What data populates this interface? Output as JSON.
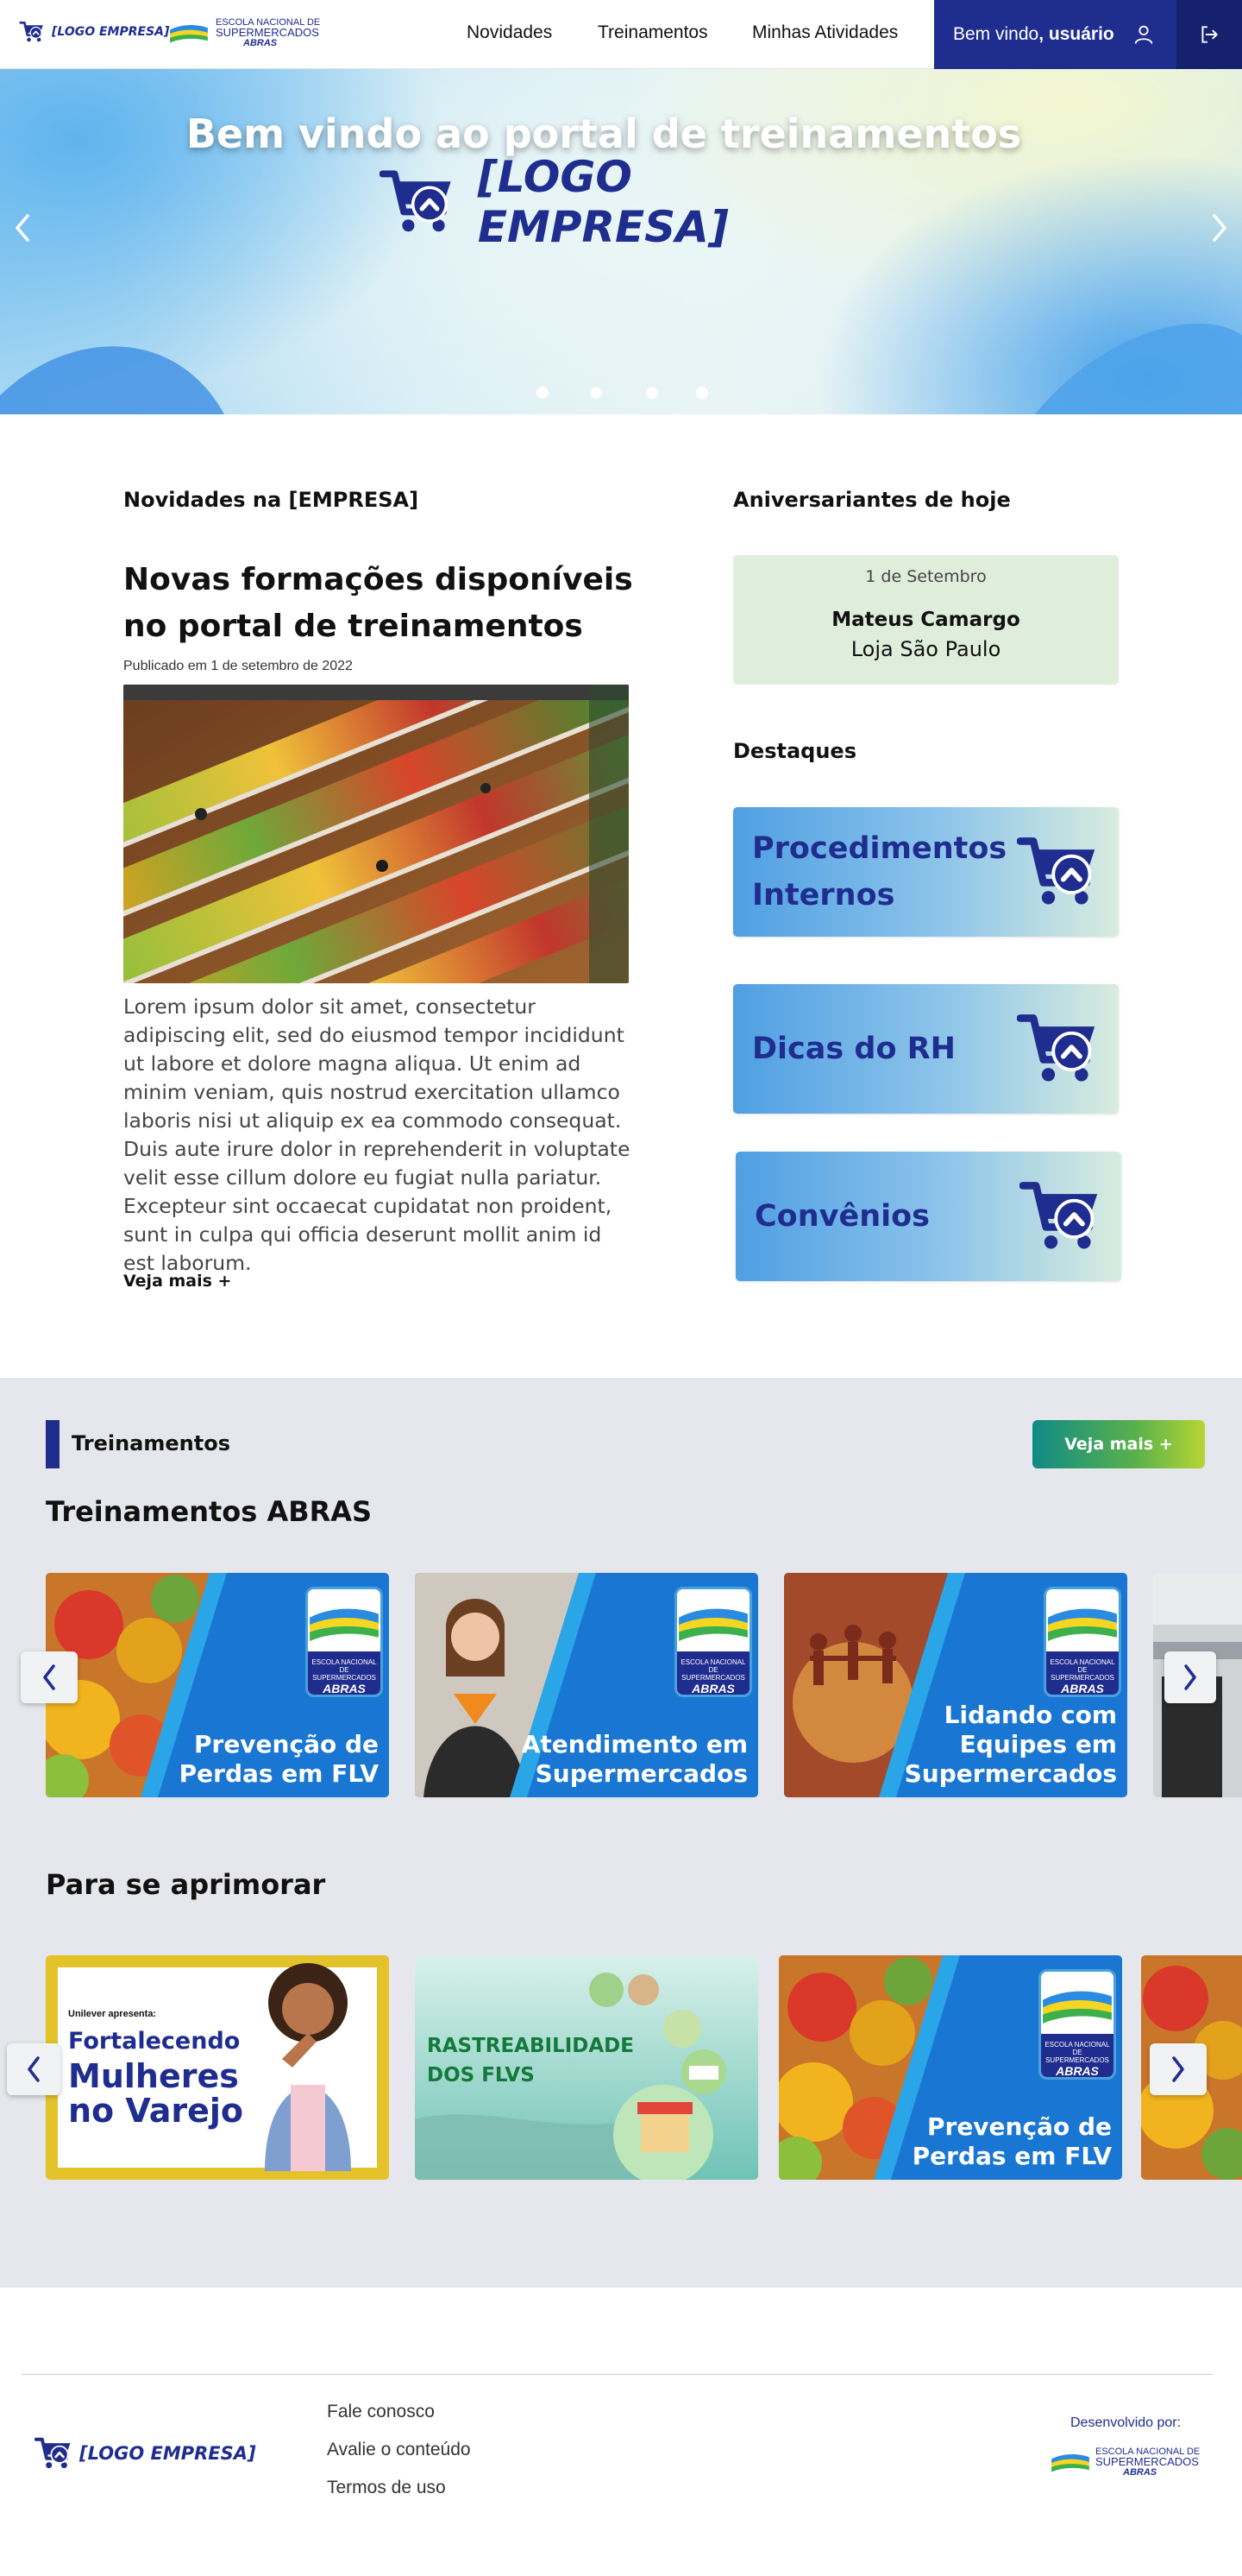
{
  "header": {
    "company_logo_text": "[LOGO EMPRESA]",
    "school_logo_lines": [
      "ESCOLA NACIONAL DE",
      "SUPERMERCADOS",
      "ABRAS"
    ],
    "nav": [
      "Novidades",
      "Treinamentos",
      "Minhas Atividades"
    ],
    "welcome_prefix": "Bem vindo",
    "welcome_user": ", usuário"
  },
  "hero": {
    "title": "Bem vindo ao portal de treinamentos",
    "logo_text": "[LOGO EMPRESA]",
    "slides": 4,
    "active_slide": 1
  },
  "news": {
    "section_title": "Novidades na [EMPRESA]",
    "headline": "Novas formações disponíveis no portal de treinamentos",
    "published": "Publicado em 1 de setembro de 2022",
    "body": "Lorem ipsum dolor sit amet, consectetur adipiscing elit, sed do eiusmod tempor incididunt ut labore et dolore magna aliqua. Ut enim ad minim veniam, quis nostrud exercitation ullamco laboris nisi ut aliquip ex ea commodo consequat. Duis aute irure dolor in reprehenderit in voluptate velit esse cillum dolore eu fugiat nulla pariatur. Excepteur sint occaecat cupidatat non proident, sunt in culpa qui officia deserunt mollit anim id est laborum.",
    "more": "Veja mais +"
  },
  "birthdays": {
    "section_title": "Aniversariantes de hoje",
    "date": "1 de Setembro",
    "name": "Mateus Camargo",
    "store": "Loja São Paulo"
  },
  "highlights": {
    "section_title": "Destaques",
    "items": [
      {
        "label_line1": "Procedimentos",
        "label_line2": "Internos"
      },
      {
        "label_line1": "Dicas do RH",
        "label_line2": ""
      },
      {
        "label_line1": "Convênios",
        "label_line2": ""
      }
    ]
  },
  "trainings": {
    "section_title": "Treinamentos",
    "more_button": "Veja mais +",
    "abras_title": "Treinamentos ABRAS",
    "abras_cards": [
      {
        "line1": "Prevenção de",
        "line2": "Perdas em FLV",
        "line3": ""
      },
      {
        "line1": "Atendimento em",
        "line2": "Supermercados",
        "line3": ""
      },
      {
        "line1": "Lidando com",
        "line2": "Equipes em",
        "line3": "Supermercados"
      }
    ],
    "improve_title": "Para se aprimorar",
    "improve_cards": [
      {
        "kicker": "Unilever apresenta:",
        "line1": "Fortalecendo",
        "line2": "Mulheres",
        "line3": "no Varejo"
      },
      {
        "line1": "RASTREABILIDADE",
        "line2": "DOS FLVS"
      },
      {
        "line1": "Prevenção de",
        "line2": "Perdas em FLV"
      }
    ],
    "badge_lines": [
      "ESCOLA NACIONAL DE",
      "SUPERMERCADOS",
      "ABRAS"
    ]
  },
  "footer": {
    "logo_text": "[LOGO EMPRESA]",
    "links": [
      "Fale conosco",
      "Avalie o conteúdo",
      "Termos de uso"
    ],
    "developed_by": "Desenvolvido por:",
    "dev_logo_lines": [
      "ESCOLA NACIONAL DE",
      "SUPERMERCADOS",
      "ABRAS"
    ]
  },
  "colors": {
    "brand_navy": "#1f2d8f",
    "band_gray": "#e6e7ec",
    "birthday_bg": "#deeedb",
    "abras_blue": "#1976d2"
  }
}
